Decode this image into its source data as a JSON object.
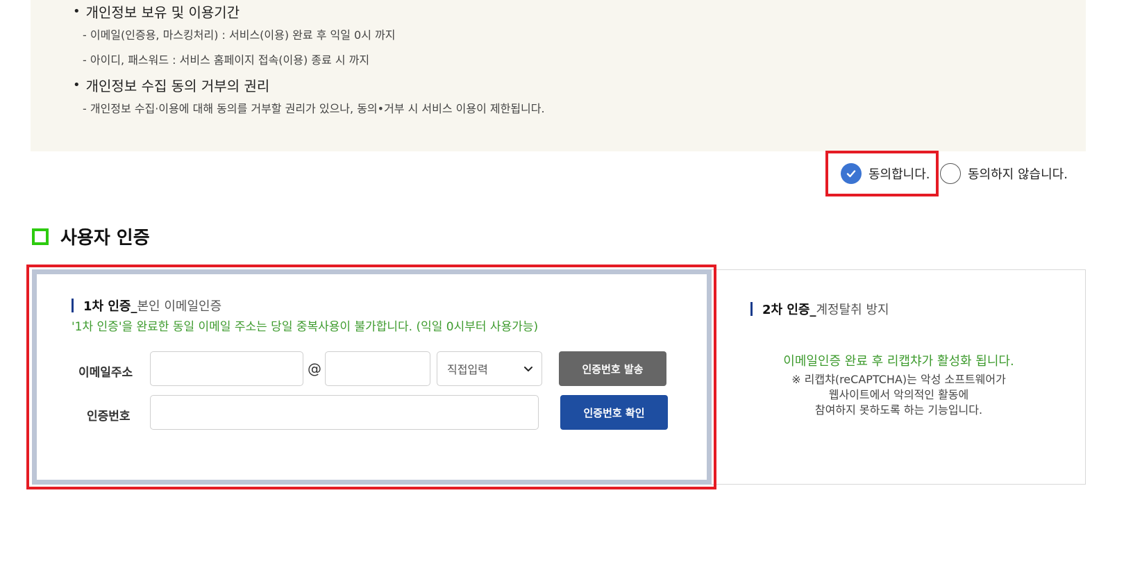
{
  "privacy": {
    "retention": {
      "heading": "개인정보 보유 및 이용기간",
      "lines": [
        "- 이메일(인증용, 마스킹처리) : 서비스(이용) 완료 후 익일 0시 까지",
        "- 아이디, 패스워드 : 서비스 홈페이지 접속(이용) 종료 시 까지"
      ]
    },
    "refusal": {
      "heading": "개인정보 수집 동의 거부의 권리",
      "lines": [
        "- 개인정보 수집·이용에 대해 동의를 거부할 권리가 있으나, 동의•거부 시 서비스 이용이 제한됩니다."
      ]
    }
  },
  "consent": {
    "agree_label": "동의합니다.",
    "disagree_label": "동의하지 않습니다.",
    "selected": "agree"
  },
  "section": {
    "title": "사용자 인증"
  },
  "auth1": {
    "title_strong": "1차 인증_",
    "title_sub": "본인 이메일인증",
    "notice": "'1차 인증'을 완료한 동일 이메일 주소는 당일 중복사용이 불가합니다. (익일 0시부터 사용가능)",
    "email_label": "이메일주소",
    "email_local_value": "",
    "at_sign": "@",
    "email_domain_value": "",
    "domain_select_value": "직접입력",
    "send_button": "인증번호 발송",
    "code_label": "인증번호",
    "code_value": "",
    "confirm_button": "인증번호 확인"
  },
  "auth2": {
    "title_strong": "2차 인증_",
    "title_sub": "계정탈취 방지",
    "notice": "이메일인증 완료 후 리캡챠가 활성화 됩니다.",
    "desc_lines": [
      "※ 리캡챠(reCAPTCHA)는 악성 소프트웨어가",
      "웹사이트에서 악의적인 활동에",
      "참여하지 못하도록 하는 기능입니다."
    ]
  },
  "colors": {
    "highlight_red": "#e51b24",
    "accent_blue": "#3b74d2",
    "button_blue": "#1e4ea1",
    "button_gray": "#666666",
    "notice_green": "#3e9b2e",
    "title_square_green": "#2dcb0f"
  },
  "icons": {
    "consent_agree": "check-circle-icon",
    "consent_disagree": "empty-circle-icon",
    "select_arrow": "chevron-down-icon"
  }
}
